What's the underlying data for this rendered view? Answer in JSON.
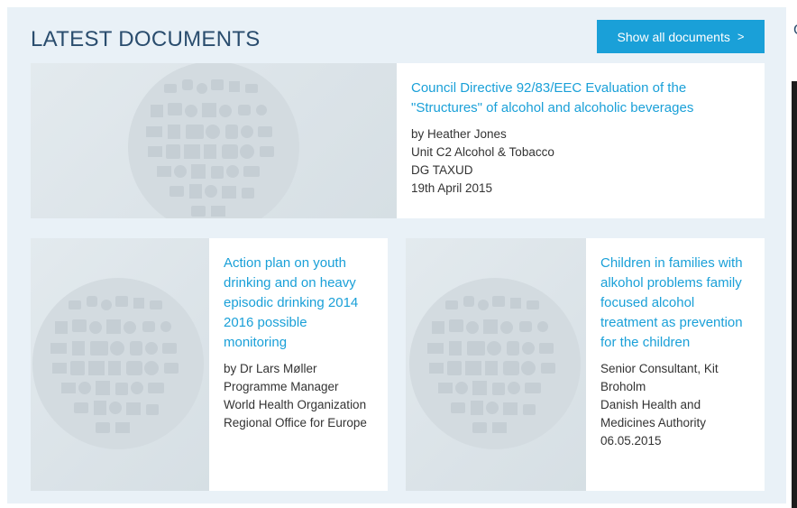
{
  "section": {
    "title": "LATEST DOCUMENTS",
    "show_all_label": "Show all documents",
    "show_all_chevron": ">"
  },
  "documents": [
    {
      "title": "Council Directive 92/83/EEC Evaluation of the \"Structures\" of alcohol and alcoholic beverages",
      "meta": [
        "by Heather Jones",
        "Unit C2 Alcohol & Tobacco",
        "DG TAXUD",
        "19th April 2015"
      ],
      "thumbnail_icon": "icon-cloud-illustration"
    },
    {
      "title": "Action plan on youth drinking and on heavy episodic drinking 2014 2016 possible monitoring",
      "meta": [
        "by Dr Lars Møller",
        "Programme Manager",
        "World Health Organization",
        "Regional Office for Europe"
      ],
      "thumbnail_icon": "icon-cloud-illustration"
    },
    {
      "title": "Children in families with alkohol problems family focused alcohol treatment as prevention for the children",
      "meta": [
        "Senior Consultant, Kit Broholm",
        "Danish Health and Medicines Authority",
        "06.05.2015"
      ],
      "thumbnail_icon": "icon-cloud-illustration"
    }
  ],
  "colors": {
    "accent": "#1aa0d8",
    "heading": "#2a4d6e",
    "panel_background": "#e9f1f7",
    "body_text": "#333333"
  },
  "side_panel": {
    "clipped_char": "C"
  }
}
